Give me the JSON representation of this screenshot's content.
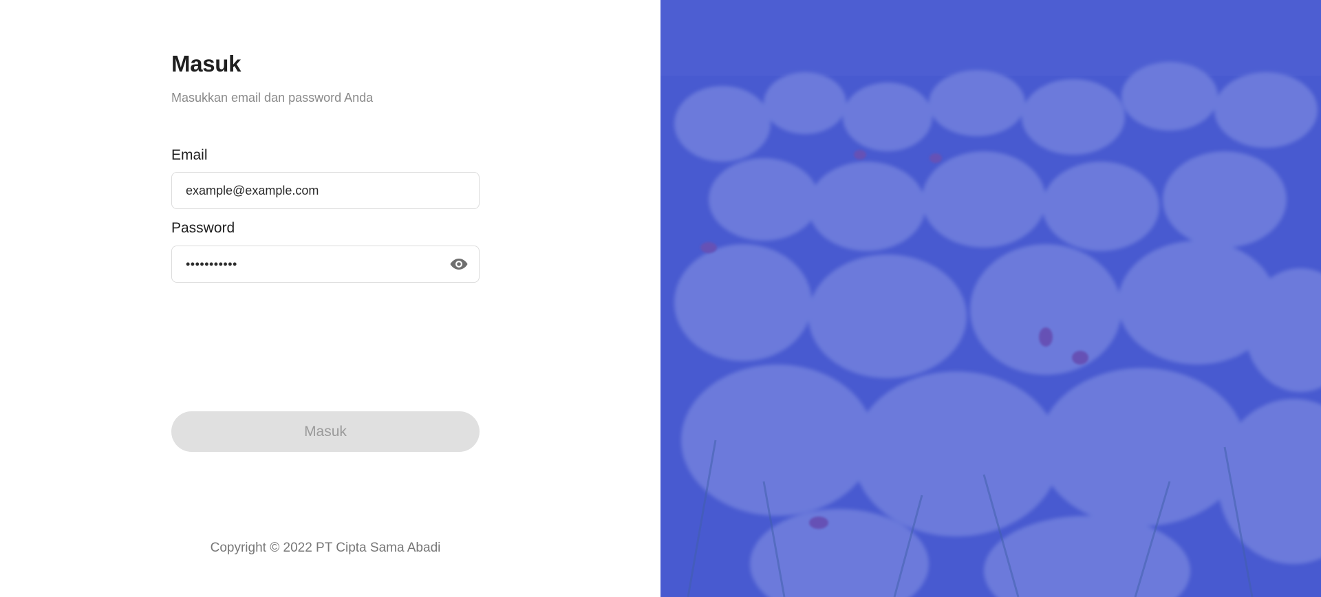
{
  "login": {
    "title": "Masuk",
    "subtitle": "Masukkan email dan password Anda",
    "email_label": "Email",
    "email_value": "example@example.com",
    "password_label": "Password",
    "password_value": "•••••••••••",
    "toggle_icon": "eye-icon",
    "submit_label": "Masuk"
  },
  "footer": {
    "copyright": "Copyright © 2022 PT Cipta Sama Abadi"
  },
  "colors": {
    "overlay": "#4a5bd0",
    "button_disabled_bg": "#e0e0e0",
    "button_disabled_text": "#9a9a9a"
  }
}
